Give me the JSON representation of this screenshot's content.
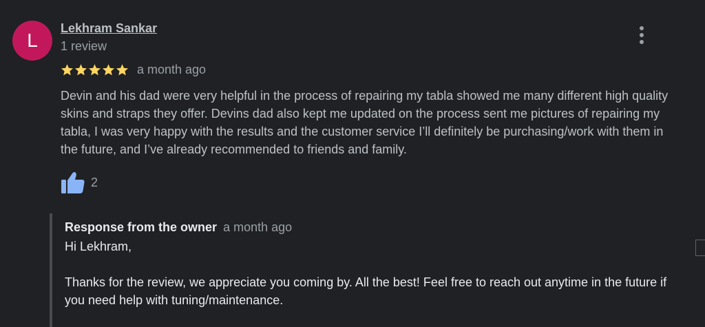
{
  "review": {
    "avatar": {
      "letter": "L",
      "color": "#c2185b"
    },
    "author": {
      "name": "Lekhram Sankar",
      "meta": "1 review"
    },
    "rating": {
      "stars": 5,
      "max": 5,
      "star_color": "#fdd663",
      "time": "a month ago"
    },
    "text": "Devin and his dad were very helpful in the process of repairing my tabla showed me many different high quality skins and straps they offer. Devins dad also kept me updated on the process sent me pictures of repairing my tabla, I was very happy with the results and the customer service I’ll definitely be purchasing/work with them in the future, and I’ve already recommended to friends and family.",
    "likes": {
      "count": "2",
      "icon": "thumbs-up-icon",
      "color": "#8ab4f8"
    },
    "more_icon": "more-vertical-icon"
  },
  "owner_response": {
    "title": "Response from the owner",
    "time": "a month ago",
    "text": "Hi Lekhram,\n\nThanks for the review, we appreciate you coming by. All the best! Feel free to reach out anytime in the future if you need help with tuning/maintenance."
  }
}
